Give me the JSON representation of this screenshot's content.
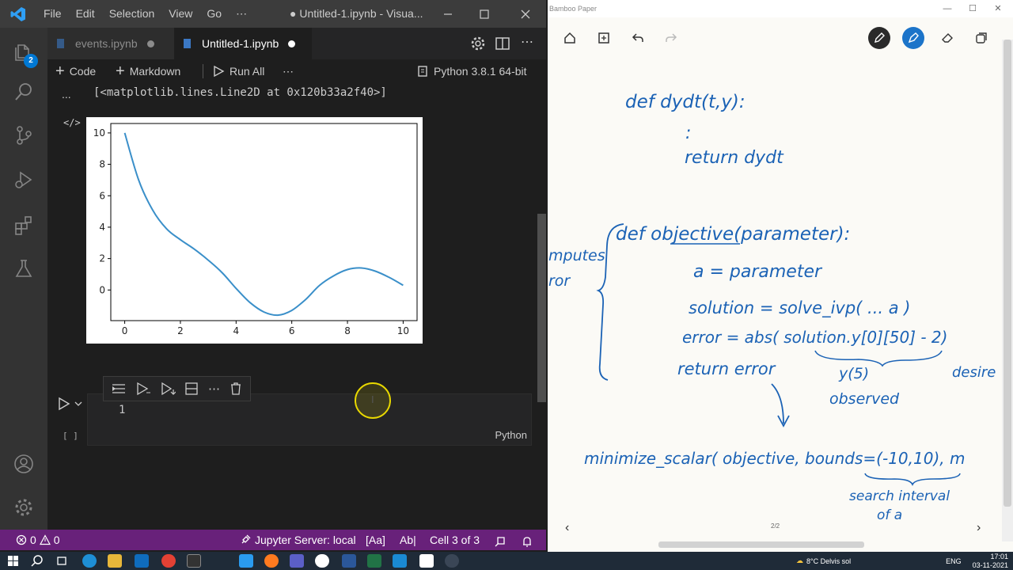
{
  "vscode": {
    "menu": [
      "File",
      "Edit",
      "Selection",
      "View",
      "Go",
      "⋯"
    ],
    "window_title": "● Untitled-1.ipynb - Visua...",
    "activity_badge": "2",
    "tabs": [
      {
        "label": "events.ipynb"
      },
      {
        "label": "Untitled-1.ipynb"
      }
    ],
    "toolbar": {
      "code": "Code",
      "markdown": "Markdown",
      "run_all": "Run All",
      "more": "⋯",
      "kernel": "Python 3.8.1 64-bit"
    },
    "output": {
      "ellipsis": "...",
      "text": "[<matplotlib.lines.Line2D at 0x120b33a2f40>]",
      "code_icon": "</>"
    },
    "cell": {
      "line_number": "1",
      "exec_count": "[ ]",
      "language": "Python"
    },
    "statusbar": {
      "errors": "0",
      "warnings": "0",
      "jupyter": "Jupyter Server: local",
      "aa": "[Aa]",
      "ab": "Ab|",
      "cell_pos": "Cell 3 of 3"
    },
    "colors": {
      "accent": "#007acc",
      "status": "#68217a",
      "line": "#3a8fc9"
    }
  },
  "chart_data": {
    "type": "line",
    "x": [
      0,
      0.5,
      1,
      1.5,
      2,
      2.5,
      3,
      3.5,
      4,
      4.5,
      5,
      5.5,
      6,
      6.5,
      7,
      7.5,
      8,
      8.5,
      9,
      9.5,
      10
    ],
    "series": [
      {
        "values": [
          10,
          7,
          5.1,
          3.9,
          3.2,
          2.6,
          1.9,
          1.1,
          0.1,
          -0.8,
          -1.4,
          -1.6,
          -1.3,
          -0.6,
          0.3,
          0.9,
          1.3,
          1.4,
          1.2,
          0.8,
          0.3
        ]
      }
    ],
    "xticks": [
      "0",
      "2",
      "4",
      "6",
      "8",
      "10"
    ],
    "yticks": [
      "10",
      "8",
      "6",
      "4",
      "2",
      "0"
    ],
    "xlim": [
      -0.5,
      10.5
    ],
    "ylim": [
      -1.95,
      10.6
    ],
    "grid": false,
    "title": "",
    "xlabel": "",
    "ylabel": ""
  },
  "bamboo": {
    "app_title": "Bamboo Paper",
    "page_indicator": "2/2",
    "handwriting": [
      "def dydt(t,y):",
      ":",
      "return dydt",
      "def objective(parameter):",
      "a = parameter",
      "solution = solve_ivp( ... a )",
      "error = abs( solution.y[0][50] - 2)",
      "return error",
      "y(5)",
      "desire",
      "observed",
      "minimize_scalar( objective, bounds=(-10,10), m",
      "search interval",
      "of a",
      "mputes",
      "ror"
    ]
  },
  "taskbar": {
    "weather": "8°C  Delvis sol",
    "lang": "ENG",
    "time": "17:01",
    "date": "03-11-2021"
  }
}
